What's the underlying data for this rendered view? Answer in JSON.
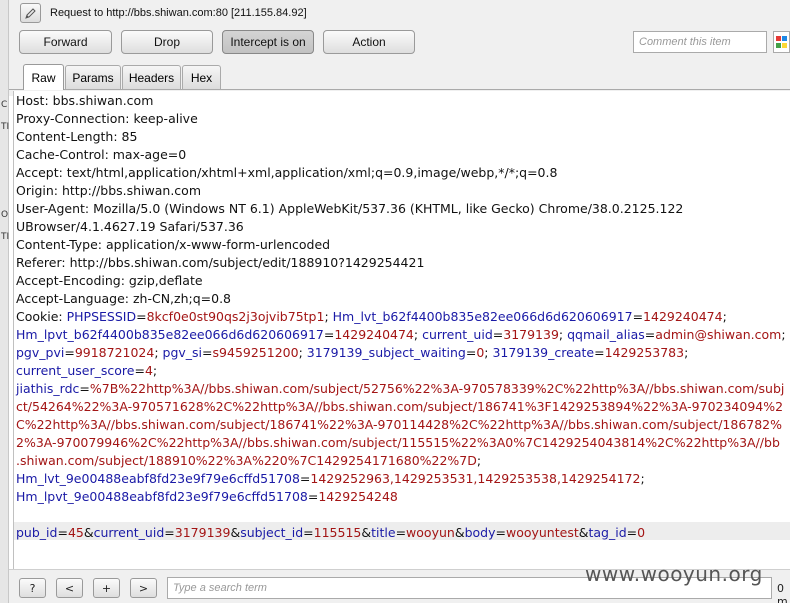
{
  "request_title": "Request to http://bbs.shiwan.com:80  [211.155.84.92]",
  "side_letters": [
    "C",
    "TI",
    "O",
    "TI"
  ],
  "toolbar": {
    "forward": "Forward",
    "drop": "Drop",
    "intercept": "Intercept is on",
    "action": "Action"
  },
  "comment_placeholder": "Comment this item",
  "tabs": [
    "Raw",
    "Params",
    "Headers",
    "Hex"
  ],
  "active_tab": "Raw",
  "headers": [
    "Host: bbs.shiwan.com",
    "Proxy-Connection: keep-alive",
    "Content-Length: 85",
    "Cache-Control: max-age=0",
    "Accept: text/html,application/xhtml+xml,application/xml;q=0.9,image/webp,*/*;q=0.8",
    "Origin: http://bbs.shiwan.com",
    "User-Agent: Mozilla/5.0 (Windows NT 6.1) AppleWebKit/537.36 (KHTML, like Gecko) Chrome/38.0.2125.122",
    "UBrowser/4.1.4627.19 Safari/537.36",
    "Content-Type: application/x-www-form-urlencoded",
    "Referer: http://bbs.shiwan.com/subject/edit/188910?1429254421",
    "Accept-Encoding: gzip,deflate",
    "Accept-Language: zh-CN,zh;q=0.8"
  ],
  "cookie_label": "Cookie: ",
  "cookie_lines": [
    [
      {
        "k": "PHPSESSID",
        "v": "8kcf0e0st90qs2j3ojvib75tp1"
      },
      {
        "s": "; "
      },
      {
        "k": "Hm_lvt_b62f4400b835e82ee066d6d620606917",
        "v": "1429240474"
      },
      {
        "s": ";"
      }
    ],
    [
      {
        "k": "Hm_lpvt_b62f4400b835e82ee066d6d620606917",
        "v": "1429240474"
      },
      {
        "s": "; "
      },
      {
        "k": "current_uid",
        "v": "3179139"
      },
      {
        "s": "; "
      },
      {
        "k": "qqmail_alias",
        "v": "admin@shiwan.com"
      },
      {
        "s": ";"
      }
    ],
    [
      {
        "k": "pgv_pvi",
        "v": "9918721024"
      },
      {
        "s": "; "
      },
      {
        "k": "pgv_si",
        "v": "s9459251200"
      },
      {
        "s": "; "
      },
      {
        "k": "3179139_subject_waiting",
        "v": "0"
      },
      {
        "s": "; "
      },
      {
        "k": "3179139_create",
        "v": "1429253783"
      },
      {
        "s": ";"
      }
    ],
    [
      {
        "k": "current_user_score",
        "v": "4"
      },
      {
        "s": ";"
      }
    ],
    [
      {
        "k": "jiathis_rdc",
        "v": "%7B%22http%3A//bbs.shiwan.com/subject/52756%22%3A-970578339%2C%22http%3A//bbs.shiwan.com/subj"
      }
    ],
    [
      {
        "t": "ct/54264%22%3A-970571628%2C%22http%3A//bbs.shiwan.com/subject/186741%3F1429253894%22%3A-970234094%2"
      }
    ],
    [
      {
        "t": "C%22http%3A//bbs.shiwan.com/subject/186741%22%3A-970114428%2C%22http%3A//bbs.shiwan.com/subject/186782%"
      }
    ],
    [
      {
        "t": "2%3A-970079946%2C%22http%3A//bbs.shiwan.com/subject/115515%22%3A0%7C1429254043814%2C%22http%3A//bb"
      }
    ],
    [
      {
        "t": ".shiwan.com/subject/188910%22%3A%220%7C1429254171680%22%7D"
      },
      {
        "s": ";"
      }
    ],
    [
      {
        "k": "Hm_lvt_9e00488eabf8fd23e9f79e6cffd51708",
        "v": "1429252963,1429253531,1429253538,1429254172"
      },
      {
        "s": ";"
      }
    ],
    [
      {
        "k": "Hm_lpvt_9e00488eabf8fd23e9f79e6cffd51708",
        "v": "1429254248"
      }
    ]
  ],
  "body_params": [
    {
      "k": "pub_id",
      "v": "45"
    },
    {
      "k": "current_uid",
      "v": "3179139"
    },
    {
      "k": "subject_id",
      "v": "115515"
    },
    {
      "k": "title",
      "v": "wooyun"
    },
    {
      "k": "body",
      "v": "wooyuntest"
    },
    {
      "k": "tag_id",
      "v": "0"
    }
  ],
  "bottom": {
    "help": "?",
    "prev": "<",
    "add": "+",
    "next": ">",
    "search_placeholder": "Type a search term",
    "match_count": "0 m"
  },
  "watermark": "www.wooyun.org",
  "colors": {
    "param_name": "#1a1aa6",
    "param_value": "#a31515",
    "highlight": "#ededed"
  }
}
